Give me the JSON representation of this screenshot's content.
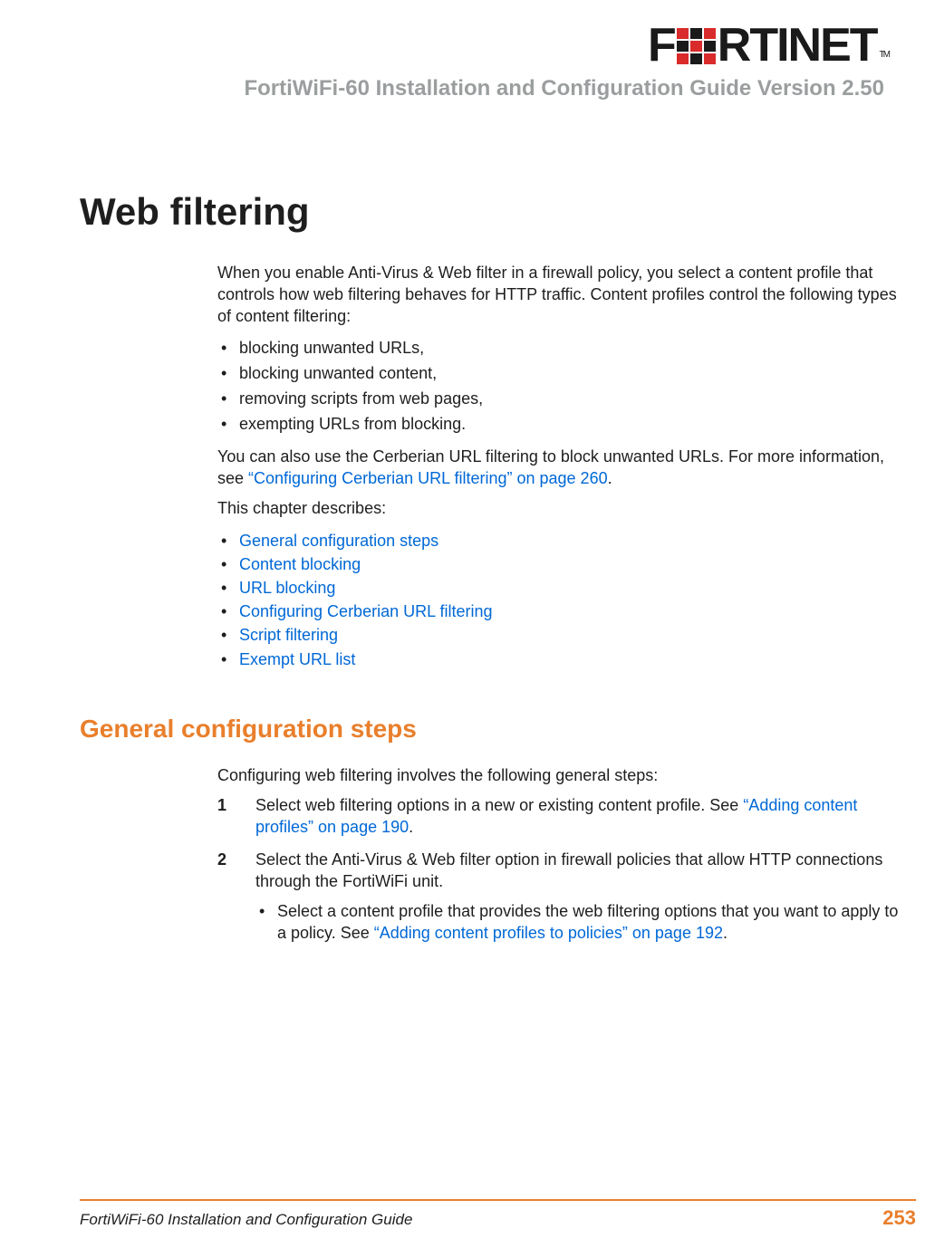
{
  "header": {
    "logo_text_1": "F",
    "logo_text_2": "RTINET",
    "tm": "TM",
    "doc_title": "FortiWiFi-60 Installation and Configuration Guide Version 2.50"
  },
  "chapter": {
    "title": "Web filtering",
    "intro": "When you enable Anti-Virus & Web filter in a firewall policy, you select a content profile that controls how web filtering behaves for HTTP traffic. Content profiles control the following types of content filtering:",
    "bullets": [
      "blocking unwanted URLs,",
      "blocking unwanted content,",
      "removing scripts from web pages,",
      "exempting URLs from blocking."
    ],
    "para2_a": "You can also use the Cerberian URL filtering to block unwanted URLs. For more information, see ",
    "para2_link": "“Configuring Cerberian URL filtering” on page 260",
    "para2_b": ".",
    "describes": "This chapter describes:",
    "toc_links": [
      "General configuration steps",
      "Content blocking",
      "URL blocking",
      "Configuring Cerberian URL filtering",
      "Script filtering",
      "Exempt URL list"
    ]
  },
  "section": {
    "heading": "General configuration steps",
    "intro": "Configuring web filtering involves the following general steps:",
    "step1_num": "1",
    "step1_a": "Select web filtering options in a new or existing content profile. See ",
    "step1_link": "“Adding content profiles” on page 190",
    "step1_b": ".",
    "step2_num": "2",
    "step2_text": "Select the Anti-Virus & Web filter option in firewall policies that allow HTTP connections through the FortiWiFi unit.",
    "step2_sub_a": "Select a content profile that provides the web filtering options that you want to apply to a policy. See ",
    "step2_sub_link": "“Adding content profiles to policies” on page 192",
    "step2_sub_b": "."
  },
  "footer": {
    "left": "FortiWiFi-60 Installation and Configuration Guide",
    "page": "253"
  }
}
